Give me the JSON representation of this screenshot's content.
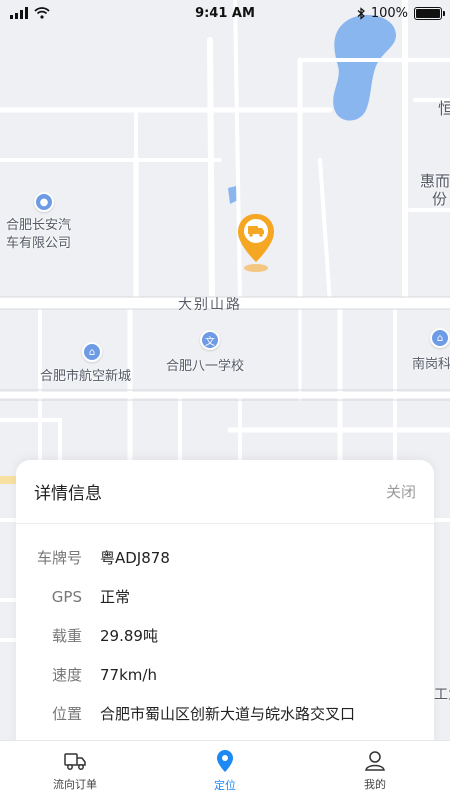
{
  "status_bar": {
    "time": "9:41 AM",
    "battery": "100%"
  },
  "map": {
    "road_name": "大别山路",
    "pois": [
      {
        "name_line1": "合肥长安汽",
        "name_line2": "车有限公司",
        "icon": "pin-icon"
      },
      {
        "name": "合肥市航空新城",
        "icon": "building-icon"
      },
      {
        "name": "合肥八一学校",
        "icon": "school-icon"
      },
      {
        "name": "南岗科",
        "icon": "building-icon"
      }
    ],
    "edge_labels": {
      "top_right": "恒",
      "right_1": "惠而",
      "right_2": "份",
      "bottom_right": "工业"
    }
  },
  "detail": {
    "title": "详情信息",
    "close_label": "关闭",
    "rows": [
      {
        "key": "车牌号",
        "value": "粤ADJ878"
      },
      {
        "key": "GPS",
        "value": "正常"
      },
      {
        "key": "载重",
        "value": "29.89吨"
      },
      {
        "key": "速度",
        "value": "77km/h"
      },
      {
        "key": "位置",
        "value": "合肥市蜀山区创新大道与皖水路交叉口"
      }
    ]
  },
  "tabs": [
    {
      "label": "流向订单",
      "icon": "truck-icon",
      "active": false
    },
    {
      "label": "定位",
      "icon": "location-icon",
      "active": true
    },
    {
      "label": "我的",
      "icon": "user-icon",
      "active": false
    }
  ],
  "colors": {
    "accent": "#1e88f3",
    "marker": "#f5a623",
    "water": "#8ab6f0"
  }
}
